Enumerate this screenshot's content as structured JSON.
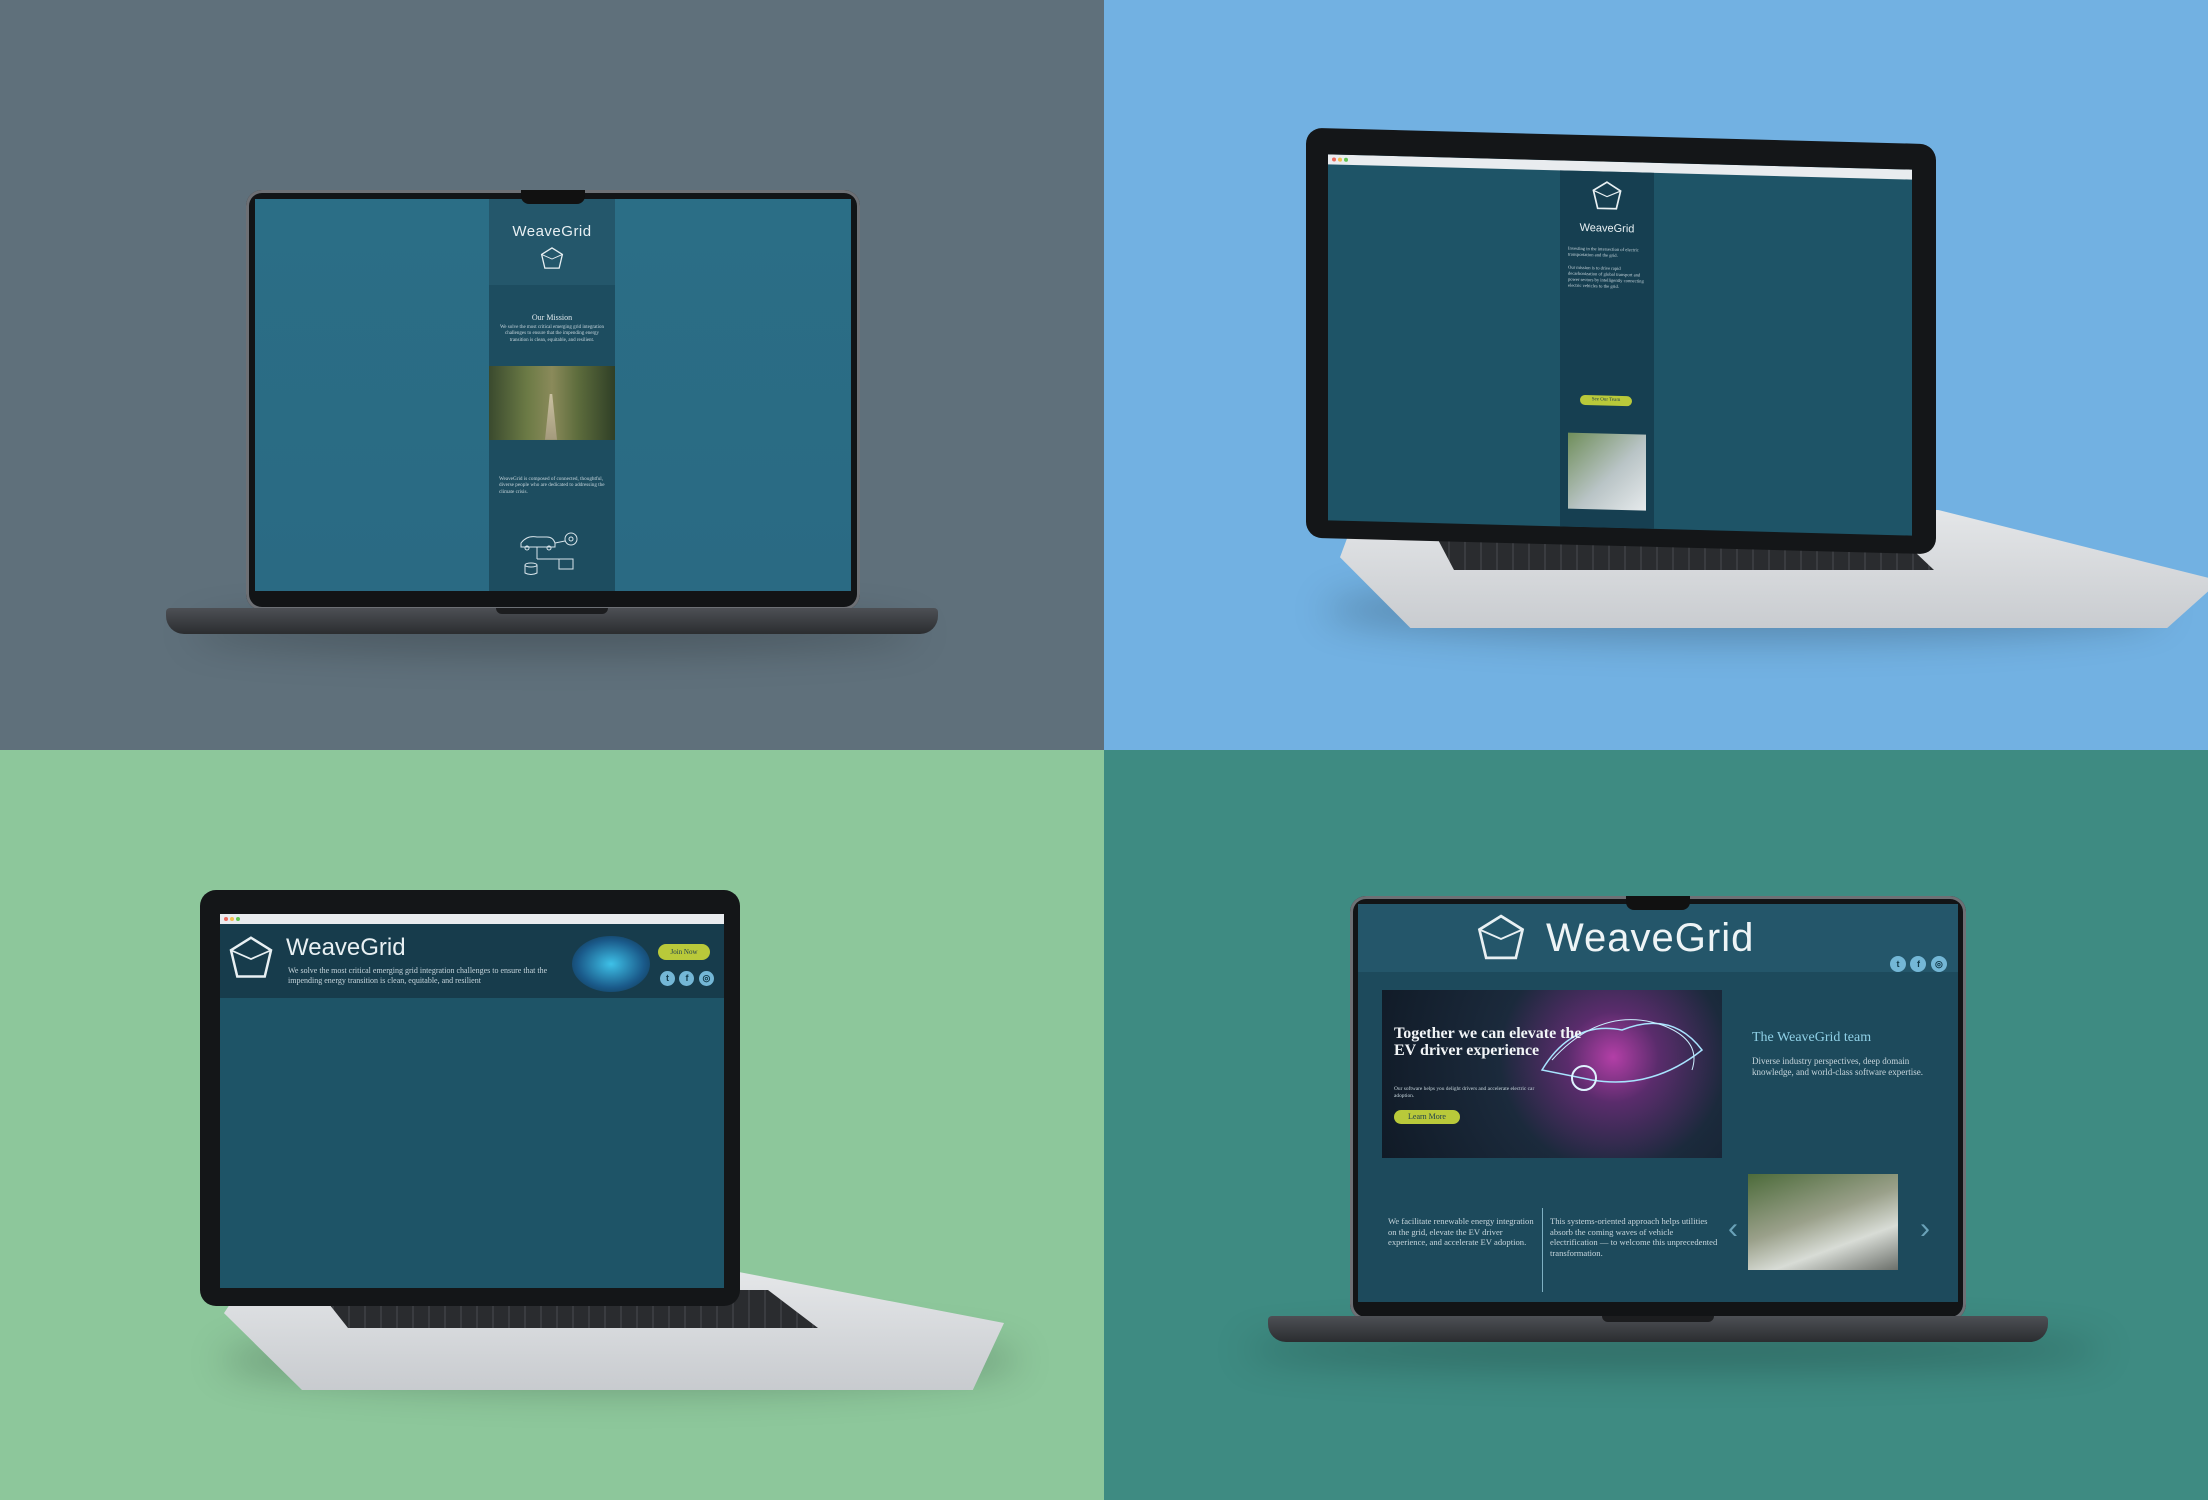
{
  "brand": {
    "name": "WeaveGrid"
  },
  "colors": {
    "q1_bg": "#5f707b",
    "q2_bg": "#72b1e2",
    "q3_bg": "#8dc79b",
    "q4_bg": "#3e8b82",
    "site_teal": "#1d4f63",
    "accent_yellow": "#b9c93a"
  },
  "q1": {
    "mission_title": "Our Mission",
    "mission_text": "We solve the most critical emerging grid integration challenges to ensure that the impending energy transition is clean, equitable, and resilient.",
    "team_text": "WeaveGrid is composed of connected, thoughtful, diverse people who are dedicated to addressing the climate crisis."
  },
  "q2": {
    "intro_text": "Investing in the intersection of electric transportation and the grid.",
    "mission_text": "Our mission is to drive rapid decarbonization of global transport and power sectors by intelligently connecting electric vehicles to the grid.",
    "button_label": "See Our Team"
  },
  "q3": {
    "tagline": "We solve the most critical emerging grid integration challenges to ensure that the impending energy transition is clean, equitable, and resilient",
    "button_label": "Join Now",
    "social_icons": [
      "twitter-icon",
      "facebook-icon",
      "instagram-icon"
    ]
  },
  "q4": {
    "hero_title": "Together we can elevate the EV driver experience",
    "hero_subtitle": "Our software helps you delight drivers and accelerate electric car adoption.",
    "button_label": "Learn More",
    "team_title": "The WeaveGrid team",
    "team_text": "Diverse industry perspectives, deep domain knowledge, and world-class software expertise.",
    "col1_text": "We facilitate renewable energy integration on the grid, elevate the EV driver experience, and accelerate EV adoption.",
    "col2_text": "This systems-oriented approach helps utilities absorb the coming waves of vehicle electrification — to welcome this unprecedented transformation.",
    "social_icons": [
      "twitter-icon",
      "facebook-icon",
      "instagram-icon"
    ]
  }
}
